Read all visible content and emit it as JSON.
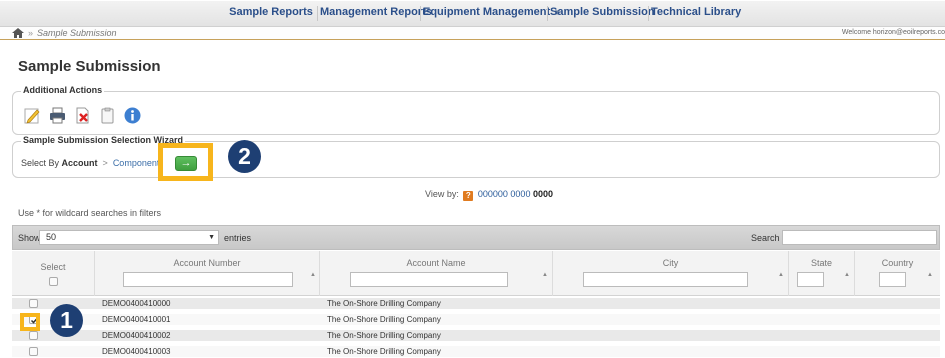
{
  "nav": {
    "items": [
      {
        "label": "Sample Reports"
      },
      {
        "label": "Management Reports"
      },
      {
        "label": "Equipment Management"
      },
      {
        "label": "Sample Submission"
      },
      {
        "label": "Technical Library"
      }
    ]
  },
  "breadcrumb": {
    "separator": "»",
    "current": "Sample Submission",
    "welcome": "Welcome horizon@eoilreports.co"
  },
  "page": {
    "title": "Sample Submission"
  },
  "actions": {
    "legend": "Additional Actions"
  },
  "wizard": {
    "legend": "Sample Submission Selection Wizard",
    "select_by": "Select By",
    "account": "Account",
    "arrow": ">",
    "component": "Components",
    "go_symbol": "→"
  },
  "badges": {
    "one": "1",
    "two": "2"
  },
  "viewby": {
    "label": "View by:",
    "icon": "?",
    "account_prefix": "000000 0000",
    "account_bold": "0000"
  },
  "hint": "Use * for wildcard searches in filters",
  "grid": {
    "show": "Show",
    "page_size": "50",
    "entries": "entries",
    "search": "Search",
    "columns": [
      {
        "label": "Select"
      },
      {
        "label": "Account Number"
      },
      {
        "label": "Account Name"
      },
      {
        "label": "City"
      },
      {
        "label": "State"
      },
      {
        "label": "Country"
      }
    ],
    "rows": [
      {
        "account": "DEMO0400410000",
        "name": "The On-Shore Drilling Company",
        "checked": false
      },
      {
        "account": "DEMO0400410001",
        "name": "The On-Shore Drilling Company",
        "checked": true
      },
      {
        "account": "DEMO0400410002",
        "name": "The On-Shore Drilling Company",
        "checked": false
      },
      {
        "account": "DEMO0400410003",
        "name": "The On-Shore Drilling Company",
        "checked": false
      }
    ]
  },
  "colors": {
    "accent": "#f7b51c",
    "badge": "#1e3f73",
    "go": "#3f9f3f",
    "nav_text": "#2b4f8a"
  }
}
